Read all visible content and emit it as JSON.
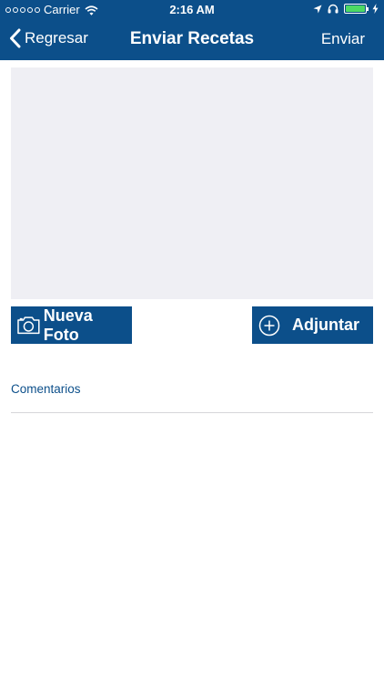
{
  "status_bar": {
    "carrier": "Carrier",
    "time": "2:16 AM"
  },
  "nav": {
    "back_label": "Regresar",
    "title": "Enviar Recetas",
    "send_label": "Enviar"
  },
  "actions": {
    "new_photo_label": "Nueva Foto",
    "attach_label": "Adjuntar"
  },
  "comments": {
    "label": "Comentarios"
  },
  "colors": {
    "brand": "#0c4f8a",
    "photo_placeholder": "#efeff4",
    "battery": "#4cd964"
  },
  "icons": [
    "chevron-left-icon",
    "camera-icon",
    "plus-circle-icon",
    "wifi-icon",
    "location-arrow-icon",
    "headphones-icon",
    "battery-icon",
    "charging-icon"
  ]
}
